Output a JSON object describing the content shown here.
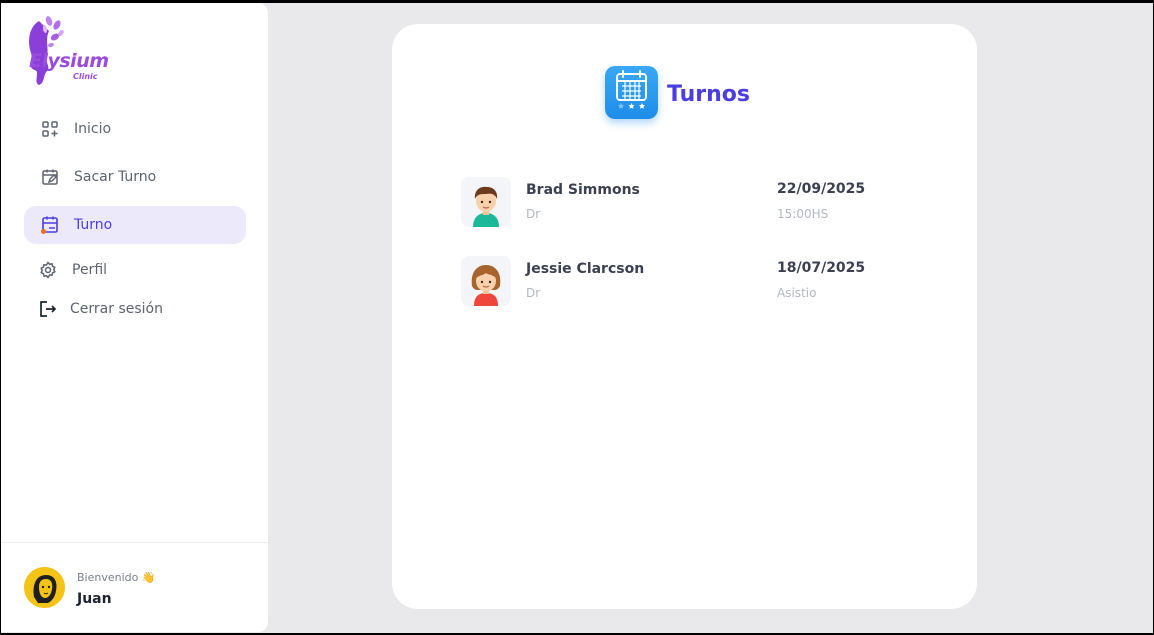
{
  "brand": {
    "name": "Elysium",
    "sub": "Clinic"
  },
  "nav": {
    "items": [
      {
        "label": "Inicio",
        "icon": "dashboard-icon"
      },
      {
        "label": "Sacar Turno",
        "icon": "calendar-edit-icon"
      },
      {
        "label": "Turno",
        "icon": "calendar-icon",
        "active": true
      },
      {
        "label": "Perfil",
        "icon": "gear-icon"
      },
      {
        "label": "Cerrar sesión",
        "icon": "logout-icon"
      }
    ]
  },
  "user": {
    "greeting": "Bienvenido 👋",
    "name": "Juan"
  },
  "main": {
    "title": "Turnos",
    "appointments": [
      {
        "name": "Brad Simmons",
        "role": "Dr",
        "date": "22/09/2025",
        "status": "15:00HS",
        "avatar": "male-avatar-icon"
      },
      {
        "name": "Jessie Clarcson",
        "role": "Dr",
        "date": "18/07/2025",
        "status": "Asistio",
        "avatar": "female-avatar-icon"
      }
    ]
  },
  "colors": {
    "accent": "#4b3de0",
    "active_bg": "#ece9fb",
    "brand": "#9b4ce0",
    "icon_blue": "#2596ee"
  }
}
